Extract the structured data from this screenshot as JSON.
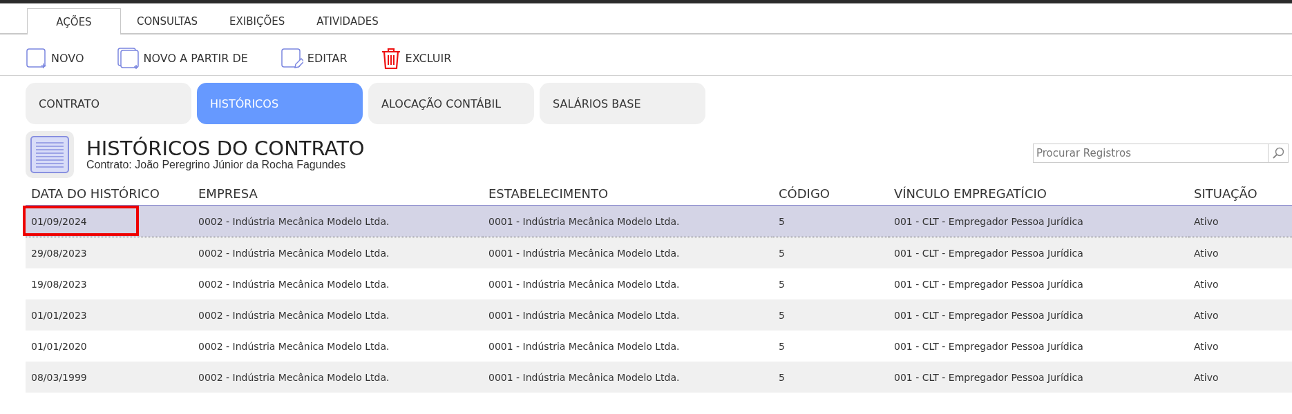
{
  "menu_tabs": [
    {
      "label": "AÇÕES",
      "selected": true
    },
    {
      "label": "CONSULTAS",
      "selected": false
    },
    {
      "label": "EXIBIÇÕES",
      "selected": false
    },
    {
      "label": "ATIVIDADES",
      "selected": false
    }
  ],
  "toolbar": [
    {
      "kind": "new",
      "label": "NOVO"
    },
    {
      "kind": "copy",
      "label": "NOVO A PARTIR DE"
    },
    {
      "kind": "edit",
      "label": "EDITAR"
    },
    {
      "kind": "delete",
      "label": "EXCLUIR"
    }
  ],
  "section_tabs": [
    {
      "label": "CONTRATO",
      "selected": false
    },
    {
      "label": "HISTÓRICOS",
      "selected": true
    },
    {
      "label": "ALOCAÇÃO CONTÁBIL",
      "selected": false
    },
    {
      "label": "SALÁRIOS BASE",
      "selected": false
    }
  ],
  "header": {
    "title": "HISTÓRICOS DO CONTRATO",
    "subtitle": "Contrato: João Peregrino Júnior da Rocha Fagundes"
  },
  "search": {
    "placeholder": "Procurar Registros"
  },
  "table": {
    "columns": [
      "DATA DO HISTÓRICO",
      "EMPRESA",
      "ESTABELECIMENTO",
      "CÓDIGO",
      "VÍNCULO EMPREGATÍCIO",
      "SITUAÇÃO"
    ],
    "rows": [
      {
        "selected": true,
        "highlighted": true,
        "cells": [
          "01/09/2024",
          "0002 - Indústria Mecânica Modelo Ltda.",
          "0001 - Indústria Mecânica Modelo Ltda.",
          "5",
          "001 - CLT - Empregador Pessoa Jurídica",
          "Ativo"
        ]
      },
      {
        "selected": false,
        "highlighted": false,
        "cells": [
          "29/08/2023",
          "0002 - Indústria Mecânica Modelo Ltda.",
          "0001 - Indústria Mecânica Modelo Ltda.",
          "5",
          "001 - CLT - Empregador Pessoa Jurídica",
          "Ativo"
        ]
      },
      {
        "selected": false,
        "highlighted": false,
        "cells": [
          "19/08/2023",
          "0002 - Indústria Mecânica Modelo Ltda.",
          "0001 - Indústria Mecânica Modelo Ltda.",
          "5",
          "001 - CLT - Empregador Pessoa Jurídica",
          "Ativo"
        ]
      },
      {
        "selected": false,
        "highlighted": false,
        "cells": [
          "01/01/2023",
          "0002 - Indústria Mecânica Modelo Ltda.",
          "0001 - Indústria Mecânica Modelo Ltda.",
          "5",
          "001 - CLT - Empregador Pessoa Jurídica",
          "Ativo"
        ]
      },
      {
        "selected": false,
        "highlighted": false,
        "cells": [
          "01/01/2020",
          "0002 - Indústria Mecânica Modelo Ltda.",
          "0001 - Indústria Mecânica Modelo Ltda.",
          "5",
          "001 - CLT - Empregador Pessoa Jurídica",
          "Ativo"
        ]
      },
      {
        "selected": false,
        "highlighted": false,
        "cells": [
          "08/03/1999",
          "0002 - Indústria Mecânica Modelo Ltda.",
          "0001 - Indústria Mecânica Modelo Ltda.",
          "5",
          "001 - CLT - Empregador Pessoa Jurídica",
          "Ativo"
        ]
      }
    ]
  }
}
